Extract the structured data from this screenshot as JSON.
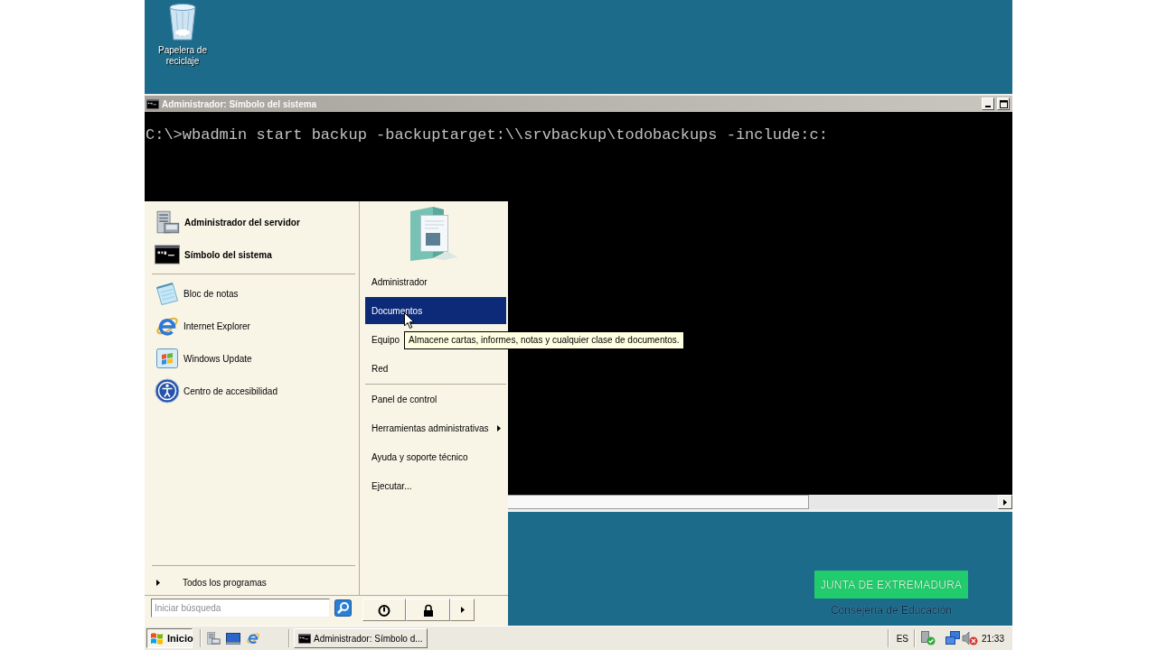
{
  "desktop": {
    "icons": [
      {
        "label": "Papelera de reciclaje",
        "kind": "recycle-bin"
      }
    ],
    "logo": {
      "title": "JUNTA DE EXTREMADURA",
      "subtitle": "Consejería de Educación"
    }
  },
  "console_window": {
    "title": "Administrador: Símbolo del sistema",
    "lines": [
      "C:\\>wbadmin start backup -backuptarget:\\\\srvbackup\\todobackups -include:c:"
    ]
  },
  "start_menu": {
    "pinned": [
      {
        "label": "Administrador del servidor",
        "kind": "server"
      },
      {
        "label": "Símbolo del sistema",
        "kind": "console"
      }
    ],
    "recent": [
      {
        "label": "Bloc de notas",
        "kind": "notepad"
      },
      {
        "label": "Internet Explorer",
        "kind": "browser"
      },
      {
        "label": "Windows Update",
        "kind": "update"
      },
      {
        "label": "Centro de accesibilidad",
        "kind": "accessibility"
      }
    ],
    "all_programs": "Todos los programas",
    "search": {
      "placeholder": "Iniciar búsqueda"
    },
    "places": [
      {
        "items": [
          {
            "label": "Administrador",
            "selected": false,
            "submenu": false
          },
          {
            "label": "Documentos",
            "selected": true,
            "submenu": false
          },
          {
            "label": "Equipo",
            "selected": false,
            "submenu": false
          },
          {
            "label": "Red",
            "selected": false,
            "submenu": false
          }
        ]
      },
      {
        "items": [
          {
            "label": "Panel de control",
            "selected": false,
            "submenu": false
          },
          {
            "label": "Herramientas administrativas",
            "selected": false,
            "submenu": true
          },
          {
            "label": "Ayuda y soporte técnico",
            "selected": false,
            "submenu": false
          },
          {
            "label": "Ejecutar...",
            "selected": false,
            "submenu": false
          }
        ]
      }
    ],
    "tooltip": "Almacene cartas, informes, notas y cualquier clase de documentos."
  },
  "taskbar": {
    "start_button": {
      "label": "Inicio",
      "pressed": true
    },
    "quick_launch": [
      {
        "kind": "server"
      },
      {
        "kind": "desktop"
      },
      {
        "kind": "browser"
      }
    ],
    "tasks": [
      {
        "label": "Administrador: Símbolo d...",
        "kind": "console",
        "selected": false
      }
    ],
    "language": "ES",
    "tray_icons": [
      {
        "kind": "security"
      },
      {
        "kind": "network"
      },
      {
        "kind": "volume-muted"
      }
    ],
    "clock": "21:33"
  }
}
